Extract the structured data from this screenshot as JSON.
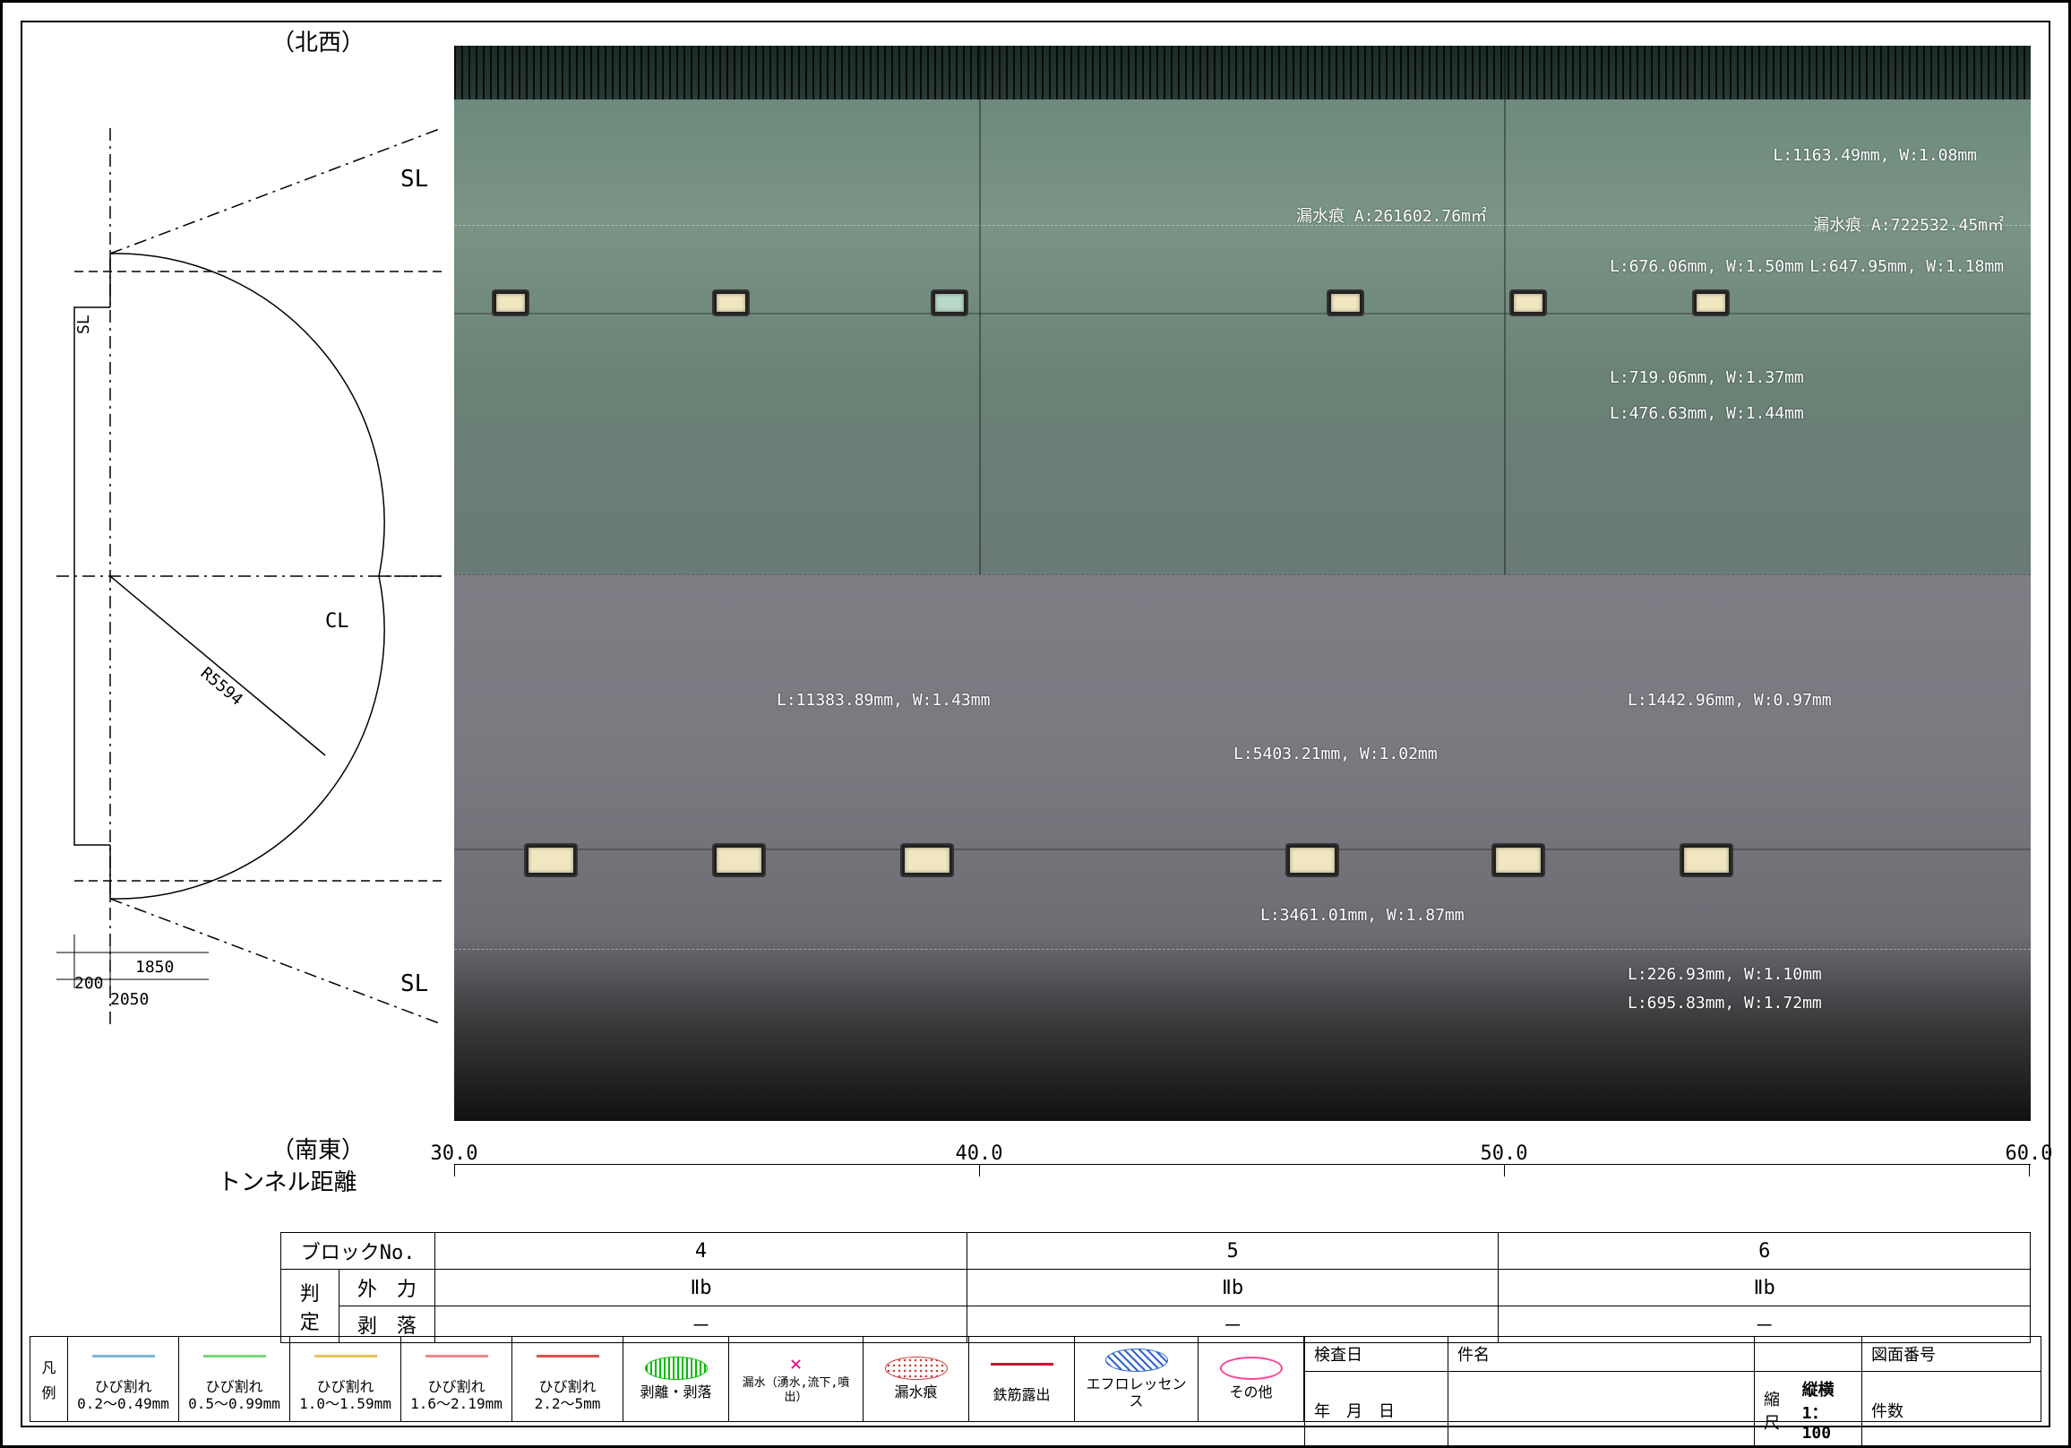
{
  "direction_nw": "（北西）",
  "direction_se": "（南東）",
  "sl_label": "SL",
  "cl_label": "CL",
  "tunnel_distance_label": "トンネル距離",
  "radius_label": "R5594",
  "sl_vertical_label": "SL",
  "dims": {
    "d200": "200",
    "d1850": "1850",
    "d2050": "2050"
  },
  "axis": {
    "t0": "30.0",
    "t1": "40.0",
    "t2": "50.0",
    "t3": "60.0"
  },
  "annotations": {
    "a1": "L:1163.49mm, W:1.08mm",
    "a2": "漏水痕 A:261602.76m㎡",
    "a3": "漏水痕 A:722532.45m㎡",
    "a4": "L:676.06mm, W:1.50mm",
    "a5": "L:647.95mm, W:1.18mm",
    "a6": "L:719.06mm, W:1.37mm",
    "a7": "L:476.63mm, W:1.44mm",
    "a8": "L:11383.89mm, W:1.43mm",
    "a9": "L:5403.21mm, W:1.02mm",
    "a10": "L:1442.96mm, W:0.97mm",
    "a11": "L:3461.01mm, W:1.87mm",
    "a12": "L:226.93mm, W:1.10mm",
    "a13": "L:695.83mm, W:1.72mm"
  },
  "block_table": {
    "row1_hdr": "ブロックNo.",
    "row2_hdr": "判",
    "row3_hdr": "定",
    "row2_sub": "外　力",
    "row3_sub": "剥　落",
    "c1": "4",
    "c2": "5",
    "c3": "6",
    "r2c1": "Ⅱb",
    "r2c2": "Ⅱb",
    "r2c3": "Ⅱb",
    "r3c1": "－",
    "r3c2": "－",
    "r3c3": "－"
  },
  "legend": {
    "head1": "凡",
    "head2": "例",
    "i1a": "ひび割れ",
    "i1b": "0.2～0.49mm",
    "i2a": "ひび割れ",
    "i2b": "0.5～0.99mm",
    "i3a": "ひび割れ",
    "i3b": "1.0～1.59mm",
    "i4a": "ひび割れ",
    "i4b": "1.6～2.19mm",
    "i5a": "ひび割れ",
    "i5b": "2.2～5mm",
    "i6": "剥離・剥落",
    "i7": "漏水（湧水,流下,噴出）",
    "i8": "漏水痕",
    "i9": "鉄筋露出",
    "i10": "エフロレッセンス",
    "i11": "その他",
    "insp_date": "検査日",
    "ymd": "年　月　日",
    "name": "件名",
    "scale_lbl": "縮尺",
    "scale_val": "縦横1：100",
    "dwg_no": "図面番号",
    "sheets": "件数"
  },
  "crack_colors": {
    "c1": "#7db6d6",
    "c2": "#7bd67b",
    "c3": "#e8c05a",
    "c4": "#e88a8a",
    "c5": "#e05050"
  }
}
